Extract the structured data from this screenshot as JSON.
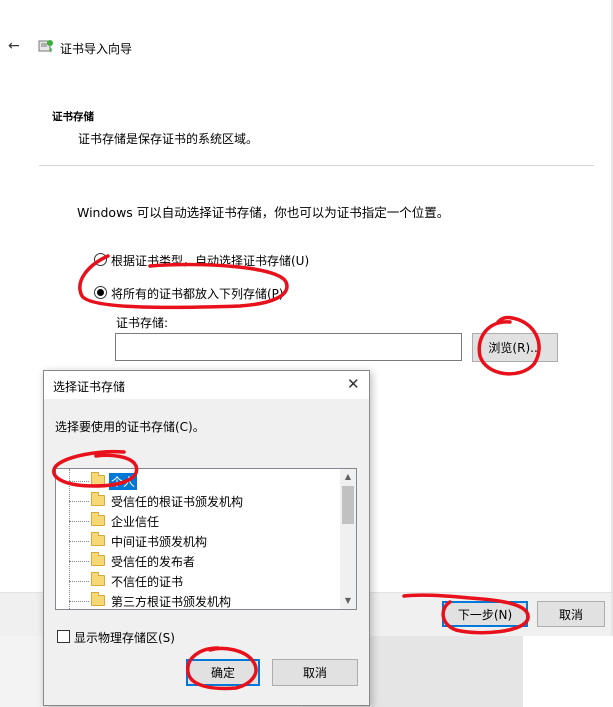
{
  "wizard": {
    "title": "证书导入向导",
    "section_title": "证书存储",
    "section_desc": "证书存储是保存证书的系统区域。",
    "intro": "Windows 可以自动选择证书存储，你也可以为证书指定一个位置。",
    "radio_auto": "根据证书类型，自动选择证书存储(U)",
    "radio_manual": "将所有的证书都放入下列存储(P)",
    "store_label": "证书存储:",
    "store_value": "",
    "browse": "浏览(R)...",
    "next": "下一步(N)",
    "cancel": "取消"
  },
  "dialog": {
    "title": "选择证书存储",
    "prompt": "选择要使用的证书存储(C)。",
    "stores": [
      "个人",
      "受信任的根证书颁发机构",
      "企业信任",
      "中间证书颁发机构",
      "受信任的发布者",
      "不信任的证书",
      "第三方根证书颁发机构"
    ],
    "selected_store": "个人",
    "show_physical": "显示物理存储区(S)",
    "ok": "确定",
    "cancel": "取消"
  },
  "colors": {
    "accent": "#0078d7",
    "annotation": "#e8101a",
    "folder": "#f8d775"
  },
  "icons": {
    "back": "back-arrow-icon",
    "wizard": "certificate-icon",
    "close": "close-icon",
    "folder": "folder-icon"
  }
}
